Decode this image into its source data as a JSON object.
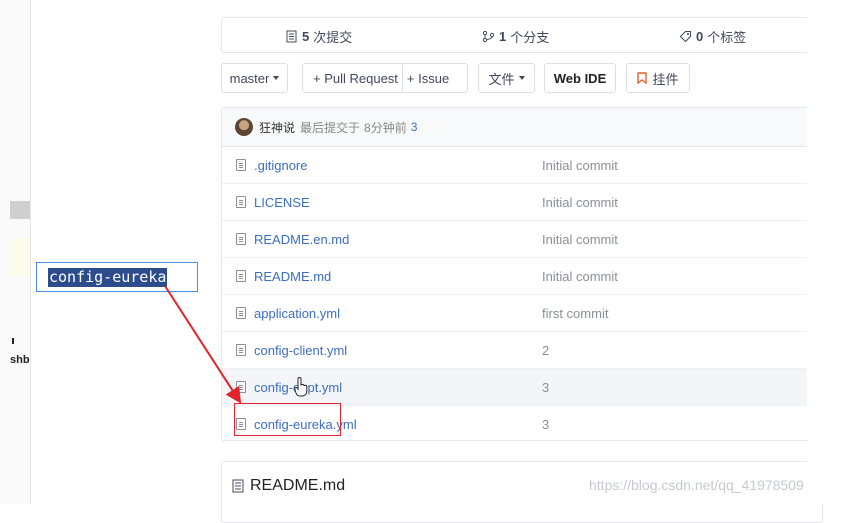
{
  "stats": {
    "commits_count": "5",
    "commits_label": "次提交",
    "branches_count": "1",
    "branches_label": "个分支",
    "tags_count": "0",
    "tags_label": "个标签"
  },
  "toolbar": {
    "branch_label": "master",
    "pull_request_label": "+ Pull Request",
    "issue_label": "+ Issue",
    "file_label": "文件",
    "webide_label": "Web IDE",
    "widget_label": "挂件"
  },
  "last_commit": {
    "author": "狂神说",
    "text": "最后提交于",
    "time": "8分钟前",
    "hash": "3"
  },
  "files": [
    {
      "name": ".gitignore",
      "message": "Initial commit"
    },
    {
      "name": "LICENSE",
      "message": "Initial commit"
    },
    {
      "name": "README.en.md",
      "message": "Initial commit"
    },
    {
      "name": "README.md",
      "message": "Initial commit"
    },
    {
      "name": "application.yml",
      "message": "first commit"
    },
    {
      "name": "config-client.yml",
      "message": "2"
    },
    {
      "name": "config-dept.yml",
      "message": "3"
    },
    {
      "name": "config-eureka.yml",
      "message": "3"
    }
  ],
  "readme": {
    "title": "README.md"
  },
  "annotation": {
    "label": "config-eureka"
  },
  "left_panel": {
    "fragment": "shb"
  },
  "watermark": "https://blog.csdn.net/qq_41978509",
  "colors": {
    "link": "#3d6ebf",
    "highlight": "#2d4c8c",
    "arrow": "#e0232d"
  }
}
